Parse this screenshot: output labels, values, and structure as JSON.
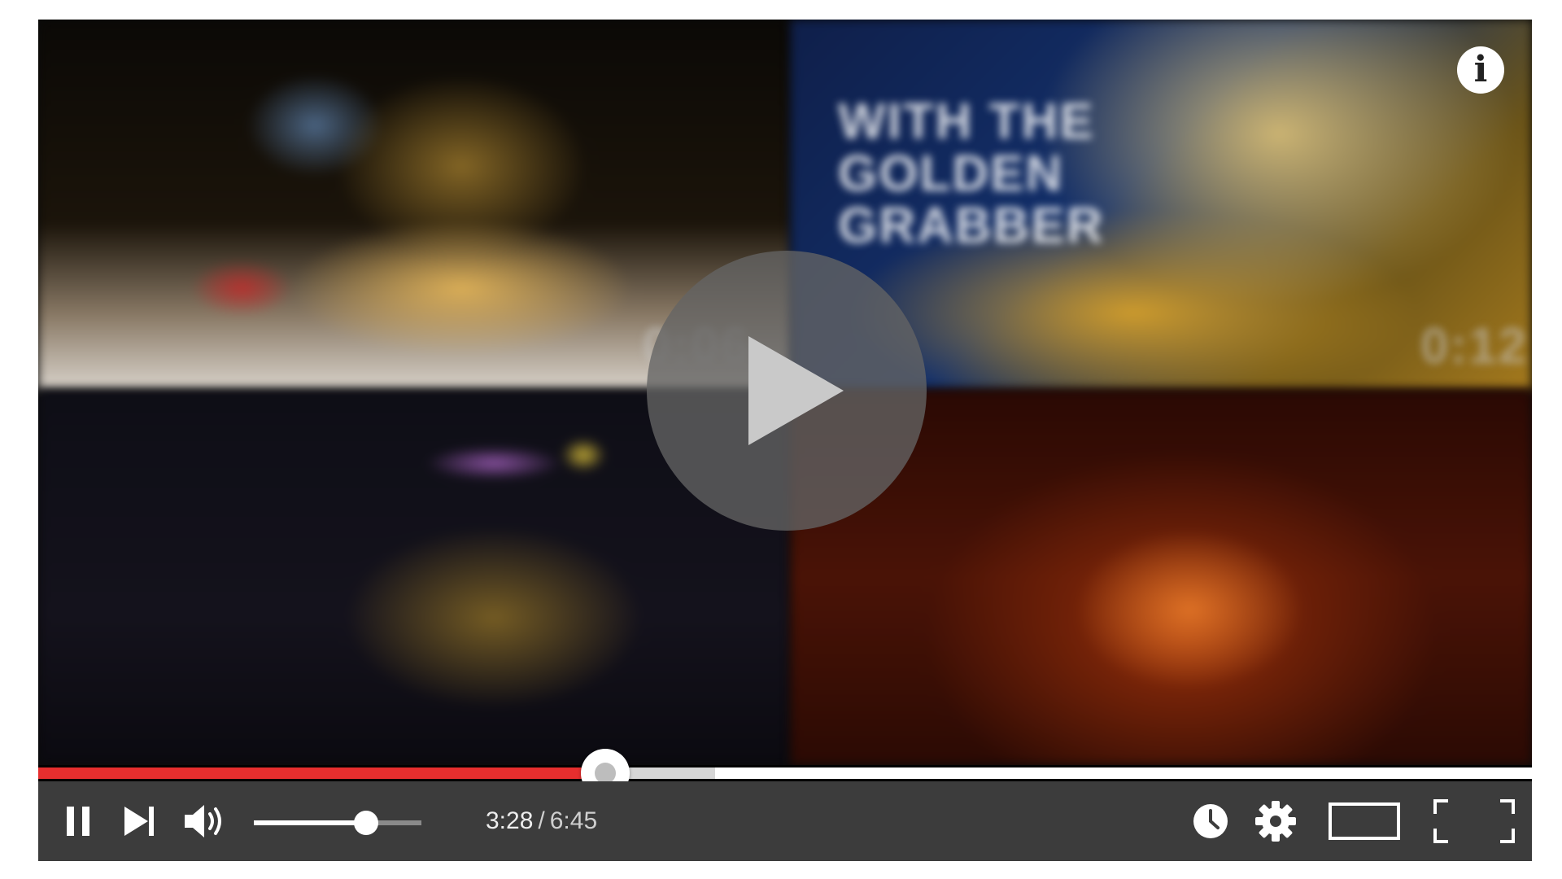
{
  "player": {
    "time": {
      "current": "3:28",
      "separator": "/",
      "duration": "6:45"
    },
    "progress": {
      "played_fraction": 0.3796,
      "buffered_fraction": 0.4531
    },
    "volume": {
      "level_fraction": 0.67
    },
    "video_thumbnail_text": {
      "title_overlay": "WITH THE GOLDEN GRABBER",
      "timestamp_1": "0:06",
      "timestamp_2": "0:12"
    },
    "info_icon_glyph": "i",
    "icons": {
      "info": "info-icon",
      "play_big": "play-icon",
      "pause": "pause-icon",
      "next": "next-icon",
      "volume": "volume-icon",
      "watch_later": "clock-icon",
      "settings": "gear-icon",
      "theater": "theater-mode-icon",
      "fullscreen": "fullscreen-icon"
    },
    "colors": {
      "progress_played": "#e62e2e",
      "progress_buffered": "#d6d6d6",
      "controls_bg": "#3c3c3c"
    }
  }
}
